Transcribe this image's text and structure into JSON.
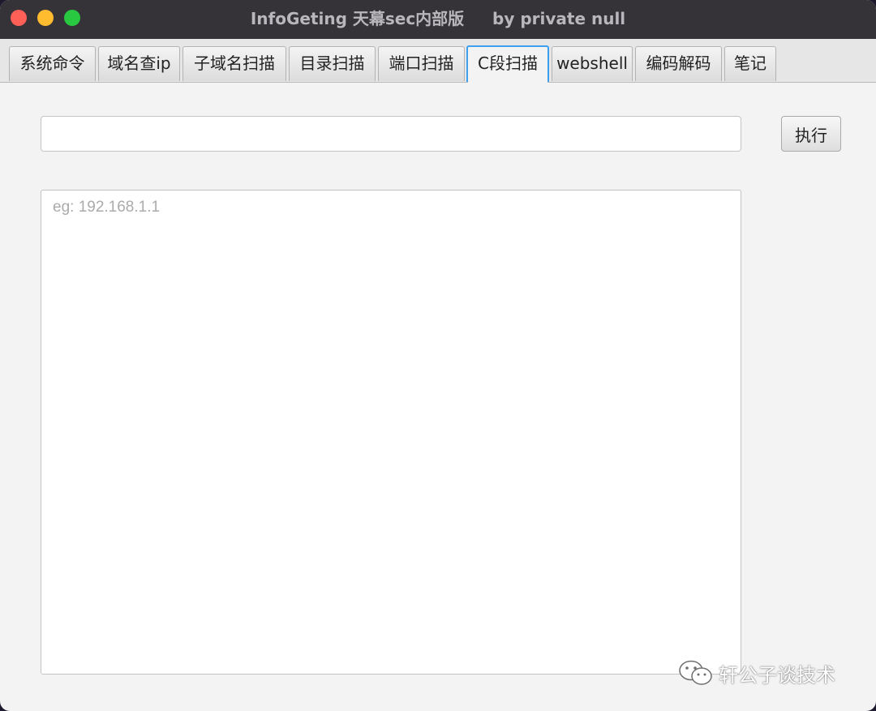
{
  "window": {
    "title": "InfoGeting 天幕sec内部版     by private null"
  },
  "tabs": [
    {
      "label": "系统命令"
    },
    {
      "label": "域名查ip"
    },
    {
      "label": "子域名扫描"
    },
    {
      "label": "目录扫描"
    },
    {
      "label": "端口扫描"
    },
    {
      "label": "C段扫描",
      "active": true
    },
    {
      "label": "webshell"
    },
    {
      "label": "编码解码"
    },
    {
      "label": "笔记"
    }
  ],
  "form": {
    "target_value": "",
    "execute_label": "执行",
    "result_placeholder": "eg: 192.168.1.1",
    "result_value": ""
  },
  "watermark": {
    "text": "轩公子谈技术",
    "icon": "wechat-icon"
  },
  "colors": {
    "titlebar": "#353238",
    "active_tab_border": "#3d9ff0",
    "close": "#fe5f57",
    "minimize": "#febc2e",
    "maximize": "#28c840"
  }
}
